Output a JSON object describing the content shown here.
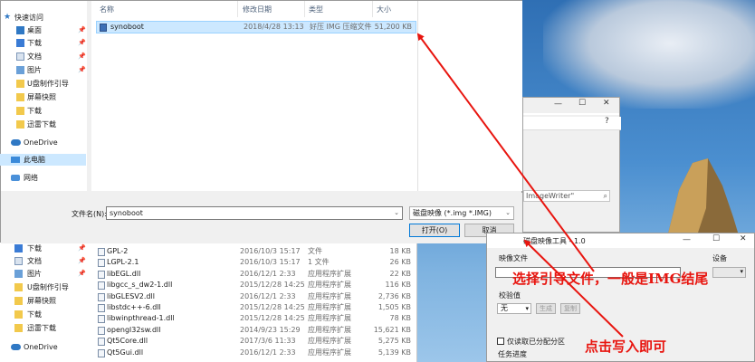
{
  "dialog": {
    "columns": {
      "name": "名称",
      "date": "修改日期",
      "type": "类型",
      "size": "大小"
    },
    "nav_items": [
      {
        "label": "快速访问",
        "icon": "star-icon"
      },
      {
        "label": "桌面",
        "icon": "desktop-icon",
        "pinned": true
      },
      {
        "label": "下载",
        "icon": "download-icon",
        "pinned": true
      },
      {
        "label": "文档",
        "icon": "document-icon",
        "pinned": true
      },
      {
        "label": "图片",
        "icon": "picture-icon",
        "pinned": true
      },
      {
        "label": "U盘制作引导",
        "icon": "folder-icon"
      },
      {
        "label": "屏幕快照",
        "icon": "folder-icon"
      },
      {
        "label": "下载",
        "icon": "folder-icon"
      },
      {
        "label": "迅雷下载",
        "icon": "folder-icon"
      },
      {
        "label": "OneDrive",
        "icon": "cloud-icon"
      },
      {
        "label": "此电脑",
        "icon": "computer-icon",
        "selected": true
      },
      {
        "label": "网络",
        "icon": "network-icon"
      }
    ],
    "files": [
      {
        "name": "synoboot",
        "date": "2018/4/28 13:13",
        "type": "好压 IMG 压缩文件",
        "size": "51,200 KB"
      }
    ],
    "filename_label": "文件名(N):",
    "filename_value": "synoboot",
    "filetype_value": "磁盘映像 (*.img *.IMG)",
    "open_button": "打开(O)",
    "cancel_button": "取消"
  },
  "back_explorer": {
    "nav_items": [
      {
        "label": "下载",
        "icon": "download-icon",
        "pinned": true
      },
      {
        "label": "文档",
        "icon": "document-icon",
        "pinned": true
      },
      {
        "label": "图片",
        "icon": "picture-icon",
        "pinned": true
      },
      {
        "label": "U盘制作引导",
        "icon": "folder-icon"
      },
      {
        "label": "屏幕快照",
        "icon": "folder-icon"
      },
      {
        "label": "下载",
        "icon": "folder-icon"
      },
      {
        "label": "迅雷下载",
        "icon": "folder-icon"
      },
      {
        "label": "OneDrive",
        "icon": "cloud-icon"
      }
    ],
    "files": [
      {
        "name": "GPL-2",
        "date": "2016/10/3 15:17",
        "type": "文件",
        "size": "18 KB"
      },
      {
        "name": "LGPL-2.1",
        "date": "2016/10/3 15:17",
        "type": "1 文件",
        "size": "26 KB"
      },
      {
        "name": "libEGL.dll",
        "date": "2016/12/1 2:33",
        "type": "应用程序扩展",
        "size": "22 KB"
      },
      {
        "name": "libgcc_s_dw2-1.dll",
        "date": "2015/12/28 14:25",
        "type": "应用程序扩展",
        "size": "116 KB"
      },
      {
        "name": "libGLESV2.dll",
        "date": "2016/12/1 2:33",
        "type": "应用程序扩展",
        "size": "2,736 KB"
      },
      {
        "name": "libstdc++-6.dll",
        "date": "2015/12/28 14:25",
        "type": "应用程序扩展",
        "size": "1,505 KB"
      },
      {
        "name": "libwinpthread-1.dll",
        "date": "2015/12/28 14:25",
        "type": "应用程序扩展",
        "size": "78 KB"
      },
      {
        "name": "opengl32sw.dll",
        "date": "2014/9/23 15:29",
        "type": "应用程序扩展",
        "size": "15,621 KB"
      },
      {
        "name": "Qt5Core.dll",
        "date": "2017/3/6 11:33",
        "type": "应用程序扩展",
        "size": "5,275 KB"
      },
      {
        "name": "Qt5Gui.dll",
        "date": "2016/12/1 2:33",
        "type": "应用程序扩展",
        "size": "5,139 KB"
      }
    ]
  },
  "imager_small": {
    "search_fragment": "ImageWriter\""
  },
  "imager": {
    "title": "磁盘映像工具 - 1.0",
    "image_file_label": "映像文件",
    "device_label": "设备",
    "hash_label": "校验值",
    "hash_select": "无",
    "generate_button": "生成",
    "copy_button": "复制",
    "read_only_alloc_label": "仅读取已分配分区",
    "progress_label": "任务进度"
  },
  "annotations": {
    "select_text": "选择引导文件，一般是IMG结尾",
    "write_text": "点击写入即可"
  },
  "colors": {
    "annotation": "#e8150f",
    "selection": "#cce8ff"
  }
}
